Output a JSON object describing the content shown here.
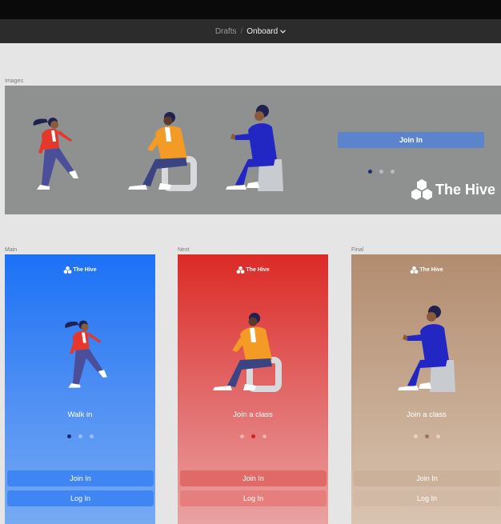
{
  "breadcrumb": {
    "parent": "Drafts",
    "separator": "/",
    "current": "Onboard"
  },
  "frames": {
    "images": {
      "label": "Images",
      "join_label": "Join In",
      "logo_text": "The Hive"
    },
    "main": {
      "label": "Main",
      "logo_text": "The Hive",
      "caption": "Walk in",
      "join_label": "Join In",
      "login_label": "Log In"
    },
    "next": {
      "label": "Next",
      "logo_text": "The Hive",
      "caption": "Join a class",
      "join_label": "Join In",
      "login_label": "Log In"
    },
    "final": {
      "label": "Final",
      "logo_text": "The Hive",
      "caption": "Join a class",
      "join_label": "Join In",
      "login_label": "Log In"
    }
  },
  "colors": {
    "main_gradient_top": "#1c71f5",
    "main_gradient_bottom": "#76aaf3",
    "next_gradient_top": "#dc2a26",
    "next_gradient_bottom": "#eaa2a2",
    "final_gradient_top": "#b28c6f",
    "final_gradient_bottom": "#d9c4b1",
    "images_bg": "#8e9190",
    "wide_button": "#5c84cd"
  },
  "icons": {
    "hive_logo": "hexagon-cluster-icon",
    "dropdown": "chevron-down-icon"
  }
}
